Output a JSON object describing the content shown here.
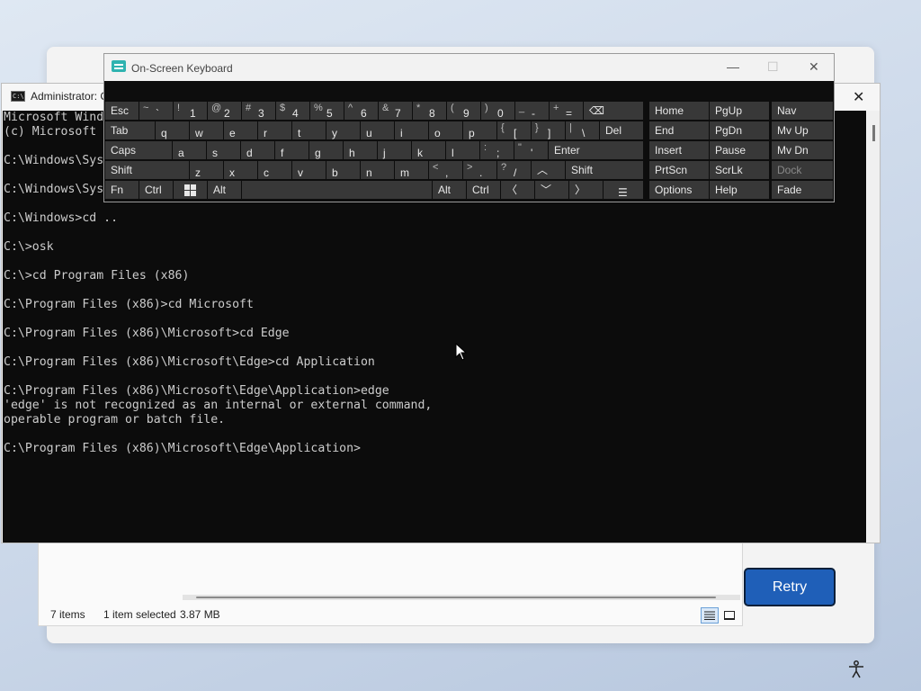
{
  "setup": {
    "retry_label": "Retry"
  },
  "explorer": {
    "items_count": "7 items",
    "selection": "1 item selected",
    "size": "3.87 MB"
  },
  "console": {
    "title": "Administrator: C",
    "lines": [
      "Microsoft Wind",
      "(c) Microsoft",
      "",
      "C:\\Windows\\Sys",
      "",
      "C:\\Windows\\Sys",
      "",
      "C:\\Windows>cd ..",
      "",
      "C:\\>osk",
      "",
      "C:\\>cd Program Files (x86)",
      "",
      "C:\\Program Files (x86)>cd Microsoft",
      "",
      "C:\\Program Files (x86)\\Microsoft>cd Edge",
      "",
      "C:\\Program Files (x86)\\Microsoft\\Edge>cd Application",
      "",
      "C:\\Program Files (x86)\\Microsoft\\Edge\\Application>edge",
      "'edge' is not recognized as an internal or external command,",
      "operable program or batch file.",
      "",
      "C:\\Program Files (x86)\\Microsoft\\Edge\\Application>"
    ]
  },
  "osk": {
    "title": "On-Screen Keyboard",
    "window_buttons": {
      "minimize": "—",
      "maximize": "☐",
      "close": "✕"
    },
    "keys": {
      "esc": "Esc",
      "tilde_u": "~",
      "tilde_l": "`",
      "k1_u": "!",
      "k1": "1",
      "k2_u": "@",
      "k2": "2",
      "k3_u": "#",
      "k3": "3",
      "k4_u": "$",
      "k4": "4",
      "k5_u": "%",
      "k5": "5",
      "k6_u": "^",
      "k6": "6",
      "k7_u": "&",
      "k7": "7",
      "k8_u": "*",
      "k8": "8",
      "k9_u": "(",
      "k9": "9",
      "k0_u": ")",
      "k0": "0",
      "minus_u": "_",
      "minus": "-",
      "plus_u": "+",
      "plus": "=",
      "backspace": "⌫",
      "tab": "Tab",
      "q": "q",
      "w": "w",
      "e": "e",
      "r": "r",
      "t": "t",
      "y": "y",
      "u": "u",
      "i": "i",
      "o": "o",
      "p": "p",
      "lbrace": "{",
      "lbracket": "[",
      "rbrace": "}",
      "rbracket": "]",
      "pipe": "|",
      "backslash": "\\",
      "del": "Del",
      "caps": "Caps",
      "a": "a",
      "s": "s",
      "d": "d",
      "f": "f",
      "g": "g",
      "h": "h",
      "j": "j",
      "k": "k",
      "l": "l",
      "colon": ":",
      "semicolon": ";",
      "quote_u": "\"",
      "quote": "'",
      "enter": "Enter",
      "shift_l": "Shift",
      "z": "z",
      "x": "x",
      "c": "c",
      "v": "v",
      "b": "b",
      "n": "n",
      "m": "m",
      "lt": "<",
      "comma": ",",
      "gt": ">",
      "period": ".",
      "qmark": "?",
      "slash": "/",
      "up": "︿",
      "shift_r": "Shift",
      "fn": "Fn",
      "ctrl_l": "Ctrl",
      "alt_l": "Alt",
      "alt_r": "Alt",
      "ctrl_r": "Ctrl",
      "left": "〈",
      "down": "﹀",
      "right": "〉",
      "menu": "☰",
      "home": "Home",
      "pgup": "PgUp",
      "nav": "Nav",
      "end": "End",
      "pgdn": "PgDn",
      "mvup": "Mv Up",
      "insert": "Insert",
      "pause": "Pause",
      "mvdn": "Mv Dn",
      "prtscn": "PrtScn",
      "scrlk": "ScrLk",
      "dock": "Dock",
      "options": "Options",
      "help": "Help",
      "fade": "Fade"
    }
  }
}
